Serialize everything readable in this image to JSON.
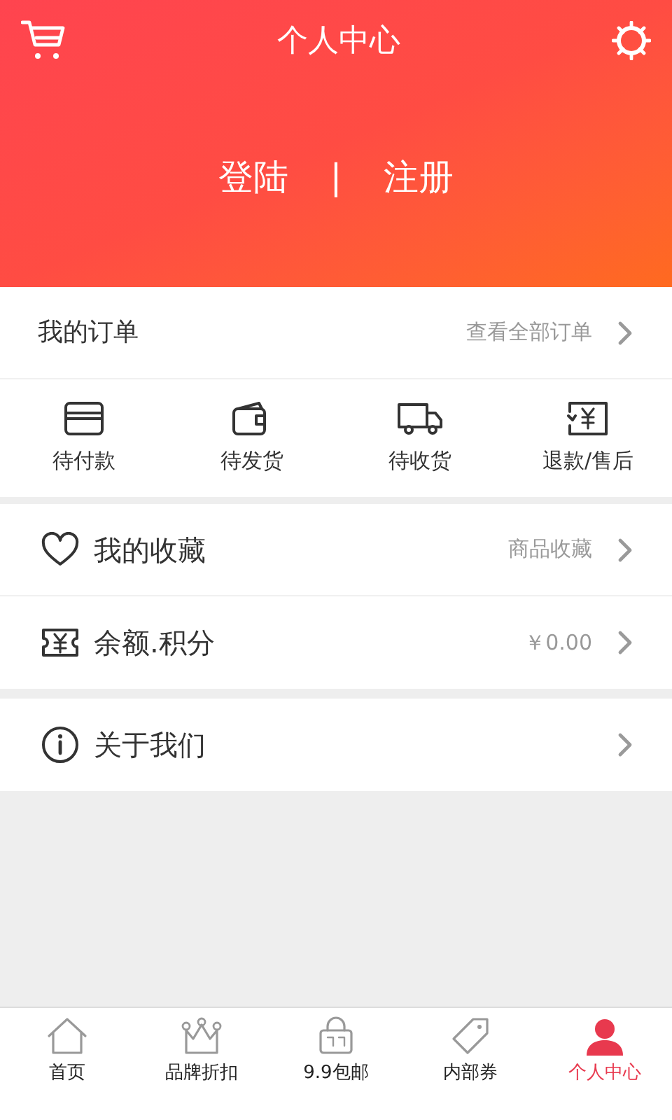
{
  "header": {
    "title": "个人中心",
    "login": "登陆",
    "separator": "|",
    "register": "注册"
  },
  "orders": {
    "title": "我的订单",
    "link": "查看全部订单",
    "statuses": [
      {
        "label": "待付款"
      },
      {
        "label": "待发货"
      },
      {
        "label": "待收货"
      },
      {
        "label": "退款/售后"
      }
    ]
  },
  "menu_groups": [
    [
      {
        "label": "我的收藏",
        "value": "商品收藏"
      },
      {
        "label": "余额.积分",
        "value": "￥0.00"
      }
    ],
    [
      {
        "label": "关于我们"
      }
    ]
  ],
  "tab_bar": [
    {
      "label": "首页",
      "selected": false
    },
    {
      "label": "品牌折扣",
      "selected": false
    },
    {
      "label": "9.9包邮",
      "selected": false
    },
    {
      "label": "内部券",
      "selected": false
    },
    {
      "label": "个人中心",
      "selected": true
    }
  ]
}
